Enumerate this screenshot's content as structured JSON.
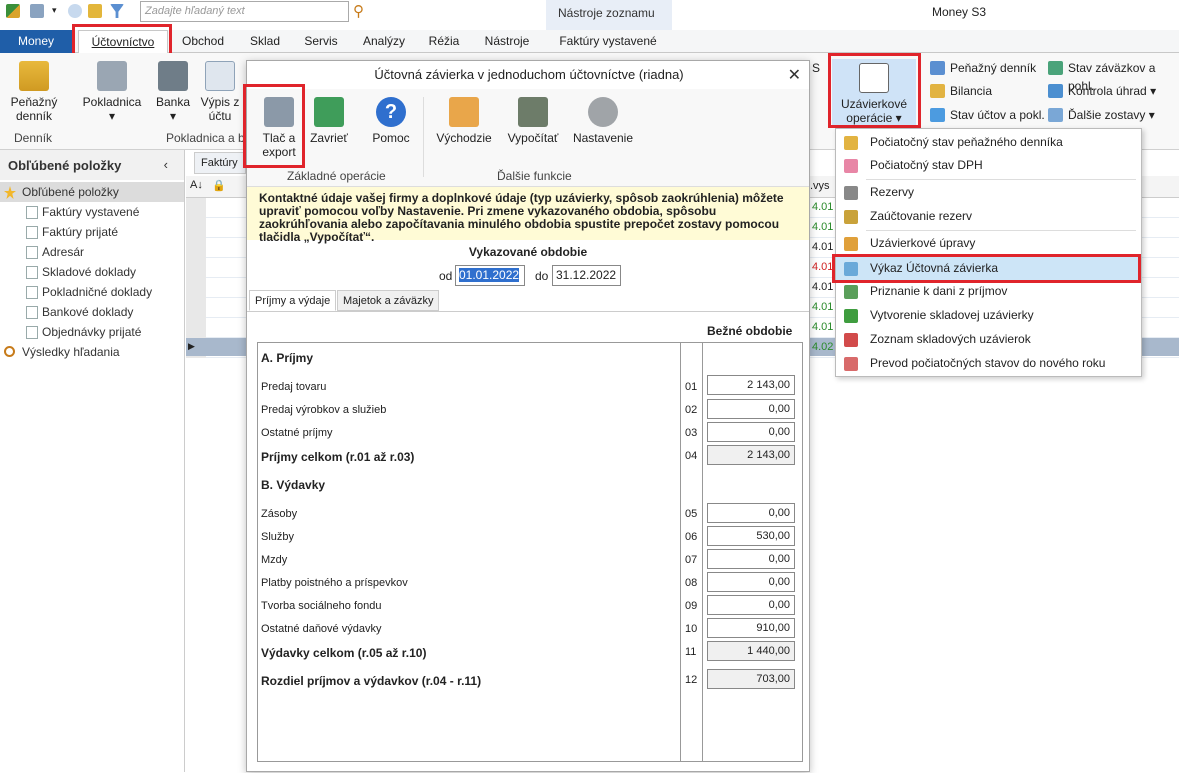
{
  "quick_access": {
    "search_placeholder": "Zadajte hľadaný text"
  },
  "context_group": "Nástroje zoznamu",
  "app_title": "Money S3",
  "tabs": [
    "Money",
    "Účtovníctvo",
    "Obchod",
    "Sklad",
    "Servis",
    "Analýzy",
    "Réžia",
    "Nástroje",
    "Faktúry vystavené"
  ],
  "ribbon": {
    "penazny_dennik": "Peňažný denník",
    "pokladnica": "Pokladnica",
    "banka": "Banka",
    "vypis_uctu": "Výpis z účtu",
    "group_dennik": "Denník",
    "group_pokladnica": "Pokladnica a b",
    "sub_tab_partial": "Faktúry v",
    "partial_s": "S",
    "uzavierkove": "Uzávierkové operácie",
    "right_buttons": [
      "Peňažný denník",
      "Bilancia",
      "Stav účtov a pokl.",
      "Stav záväzkov a pohl.",
      "Kontrola úhrad",
      "Ďalšie zostavy"
    ]
  },
  "sidebar": {
    "title": "Obľúbené položky",
    "items": [
      "Obľúbené položky",
      "Faktúry vystavené",
      "Faktúry prijaté",
      "Adresár",
      "Skladové doklady",
      "Pokladničné doklady",
      "Bankové doklady",
      "Objednávky prijaté",
      "Výsledky hľadania"
    ]
  },
  "grid_right": {
    "header": ".vys",
    "values": [
      "4.01",
      "4.01",
      "4.01",
      "4.01",
      "4.01",
      "4.01",
      "4.01",
      "4.02"
    ]
  },
  "dialog": {
    "title": "Účtovná závierka v jednoduchom účtovníctve (riadna)",
    "buttons": {
      "tlac": "Tlač a export",
      "zavriet": "Zavrieť",
      "pomoc": "Pomoc",
      "vychodzie": "Východzie",
      "vypocitat": "Vypočítať",
      "nastavenie": "Nastavenie"
    },
    "group_zakladne": "Základné operácie",
    "group_dalsie": "Ďalšie funkcie",
    "info": "Kontaktné údaje vašej firmy a doplnkové údaje (typ uzávierky, spôsob zaokrúhlenia) môžete upraviť pomocou voľby Nastavenie. Pri zmene vykazovaného obdobia, spôsobu zaokrúhľovania alebo započítavania minulého obdobia spustite prepočet zostavy pomocou tlačidla „Vypočítať“.",
    "period_title": "Vykazované obdobie",
    "od_label": "od",
    "od_value": "01.01.2022",
    "do_label": "do",
    "do_value": "31.12.2022",
    "subtabs": [
      "Príjmy a výdaje",
      "Majetok a záväzky"
    ],
    "column_header": "Bežné obdobie",
    "section_a": "A. Príjmy",
    "section_b": "B. Výdavky",
    "rows": [
      {
        "label": "Predaj tovaru",
        "num": "01",
        "value": "2 143,00"
      },
      {
        "label": "Predaj výrobkov a služieb",
        "num": "02",
        "value": "0,00"
      },
      {
        "label": "Ostatné príjmy",
        "num": "03",
        "value": "0,00"
      },
      {
        "label": "Príjmy celkom (r.01 až r.03)",
        "num": "04",
        "value": "2 143,00"
      },
      {
        "label": "Zásoby",
        "num": "05",
        "value": "0,00"
      },
      {
        "label": "Služby",
        "num": "06",
        "value": "530,00"
      },
      {
        "label": "Mzdy",
        "num": "07",
        "value": "0,00"
      },
      {
        "label": "Platby poistného a príspevkov",
        "num": "08",
        "value": "0,00"
      },
      {
        "label": "Tvorba sociálneho fondu",
        "num": "09",
        "value": "0,00"
      },
      {
        "label": "Ostatné daňové výdavky",
        "num": "10",
        "value": "910,00"
      },
      {
        "label": "Výdavky celkom (r.05 až r.10)",
        "num": "11",
        "value": "1 440,00"
      },
      {
        "label": "Rozdiel príjmov a výdavkov (r.04 - r.11)",
        "num": "12",
        "value": "703,00"
      }
    ]
  },
  "menu": {
    "items": [
      "Počiatočný stav peňažného denníka",
      "Počiatočný stav DPH",
      "Rezervy",
      "Zaúčtovanie rezerv",
      "Uzávierkové úpravy",
      "Výkaz Účtovná závierka",
      "Priznanie k dani z príjmov",
      "Vytvorenie skladovej uzávierky",
      "Zoznam skladových uzávierok",
      "Prevod počiatočných stavov do nového roku"
    ]
  }
}
